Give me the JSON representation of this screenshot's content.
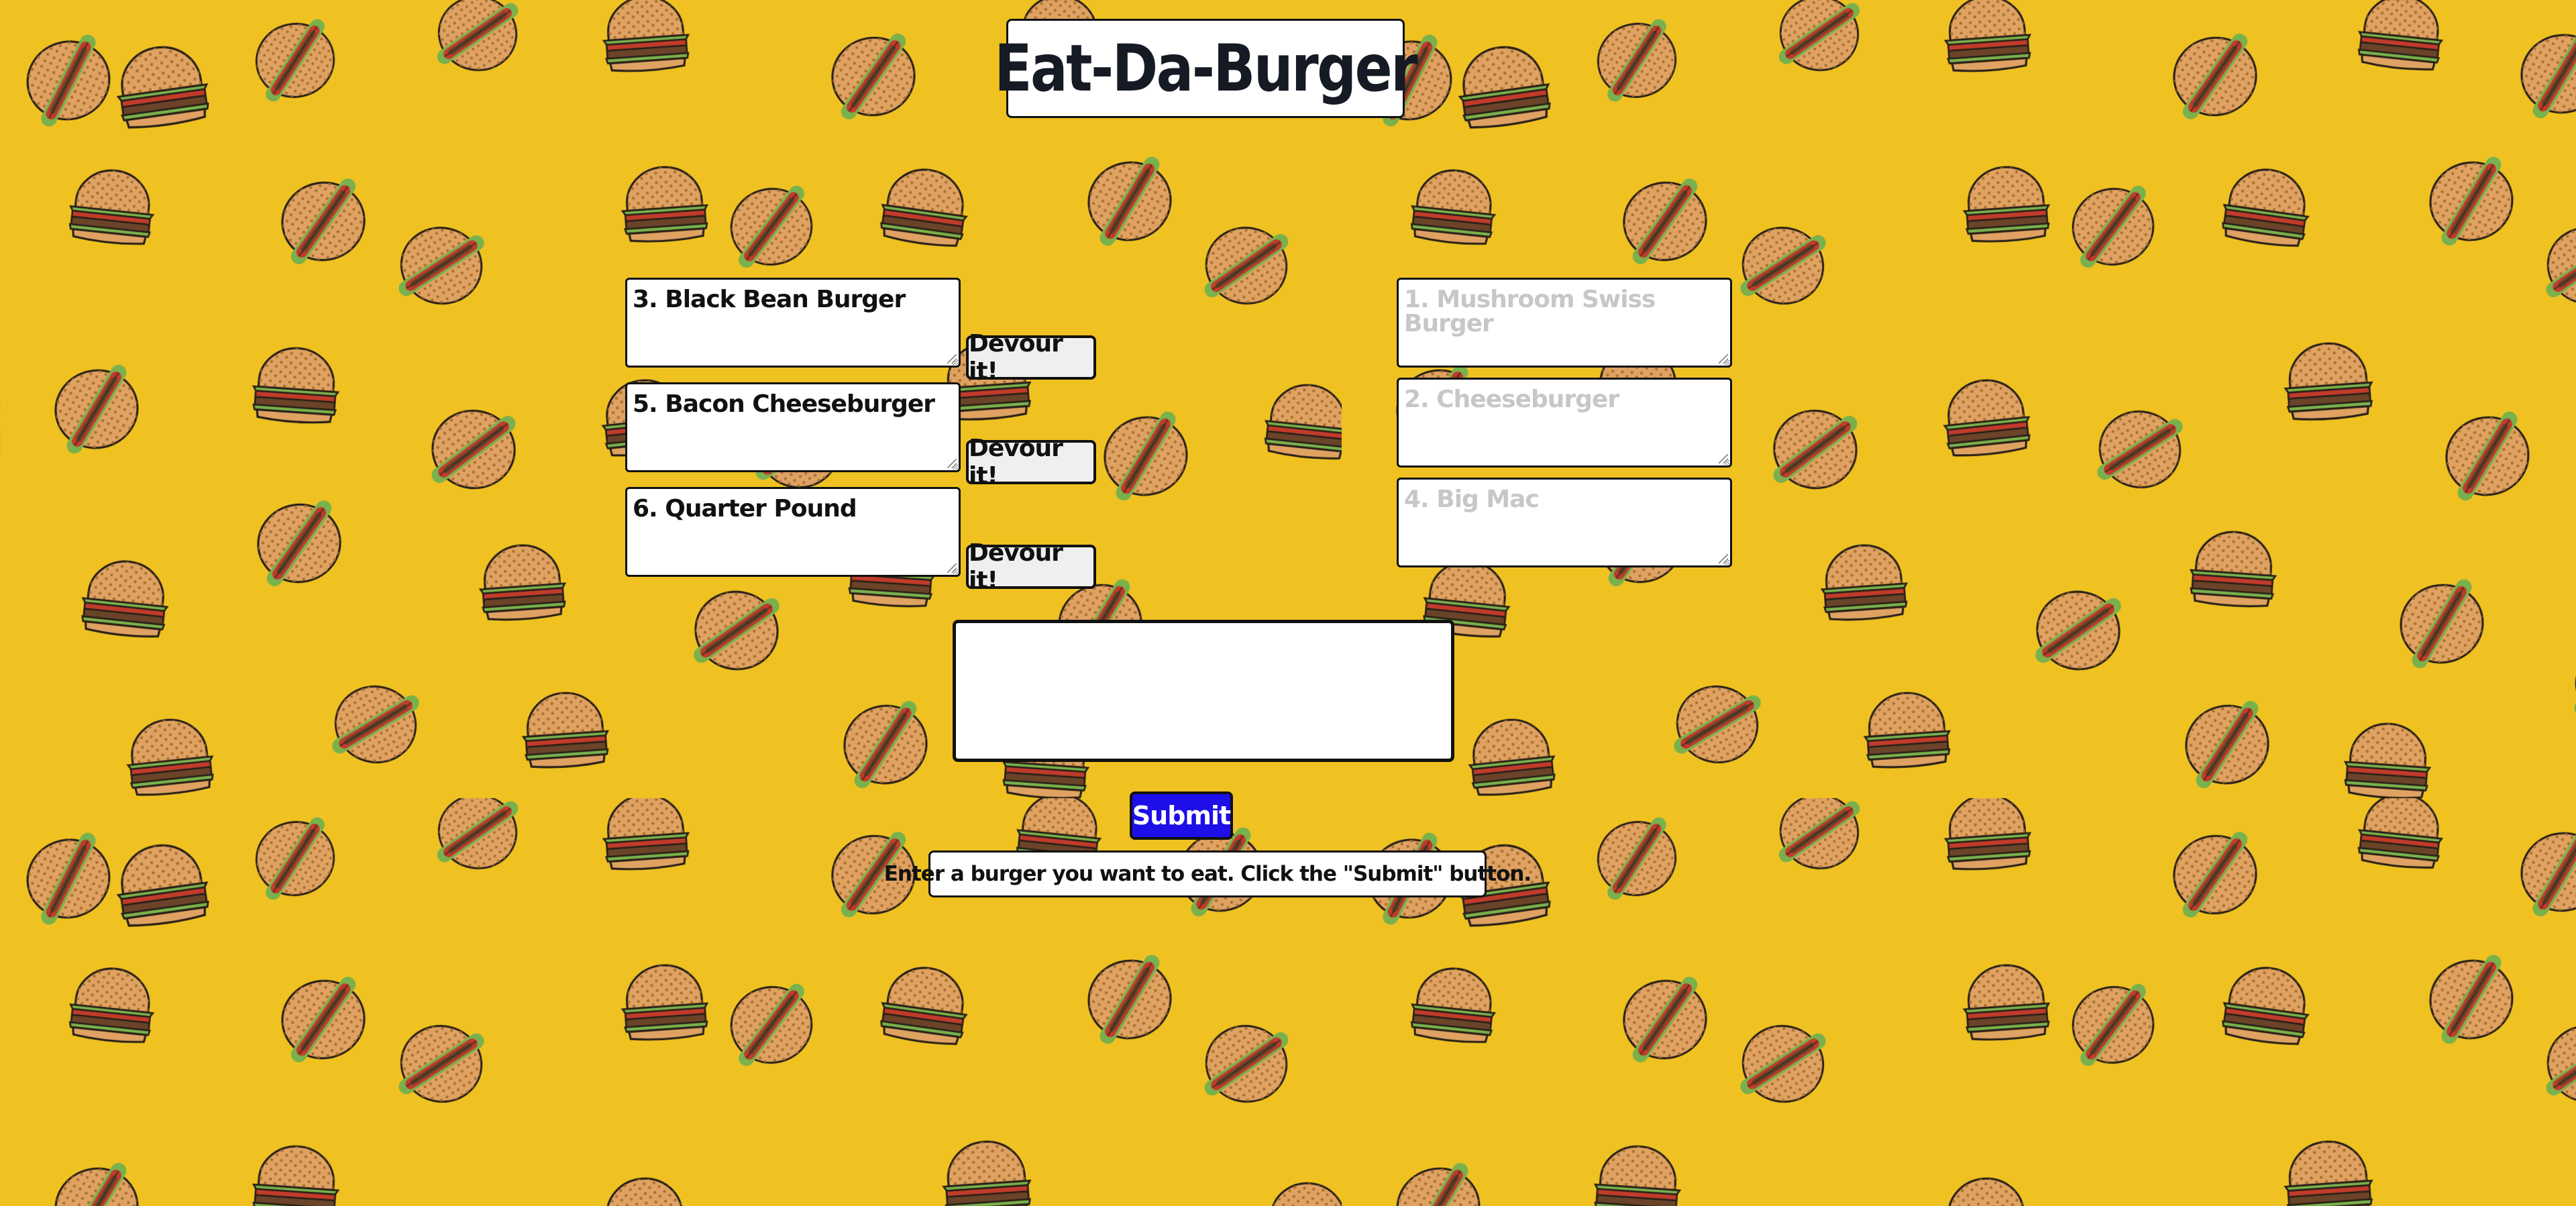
{
  "page": {
    "title": "Eat-Da-Burger",
    "background_color": "#efc222"
  },
  "uneaten_burgers": [
    {
      "label": "3. Black Bean Burger",
      "button_label": "Devour it!"
    },
    {
      "label": "5. Bacon Cheeseburger",
      "button_label": "Devour it!"
    },
    {
      "label": "6. Quarter Pound",
      "button_label": "Devour it!"
    }
  ],
  "eaten_burgers": [
    {
      "label": "1. Mushroom Swiss Burger"
    },
    {
      "label": "2. Cheeseburger"
    },
    {
      "label": "4. Big Mac"
    }
  ],
  "form": {
    "input_value": "",
    "submit_label": "Submit",
    "submit_color": "#1e0ee8",
    "instructions": "Enter a burger you want to eat. Click the \"Submit\" button."
  },
  "background_icon": "burger-icon"
}
